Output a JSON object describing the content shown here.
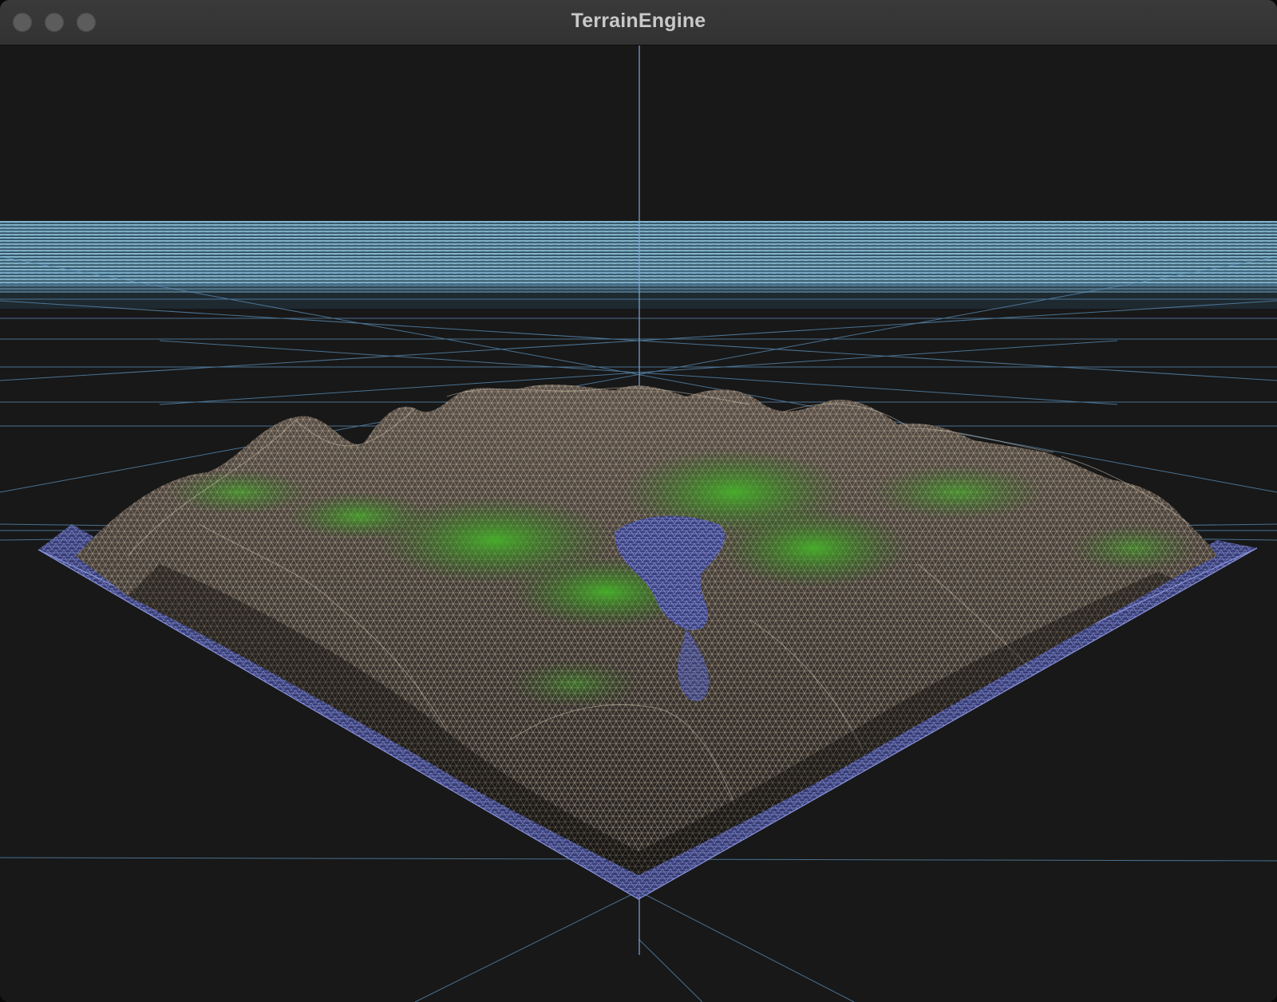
{
  "window": {
    "title": "TerrainEngine"
  },
  "controls": {
    "close": "close-button",
    "minimize": "minimize-button",
    "maximize": "zoom-button"
  },
  "colors": {
    "background": "#181818",
    "titlebar": "#353535",
    "grid": "#5b8fb8",
    "water": "#6f79c8",
    "grass": "#4fa534",
    "rock": "#c7b29a",
    "horizon_water": "#8fc4dc"
  },
  "scene": {
    "render_mode": "wireframe",
    "elements": [
      "ground-grid",
      "horizon-ocean",
      "terrain-mesh",
      "lake",
      "base-plate"
    ]
  }
}
